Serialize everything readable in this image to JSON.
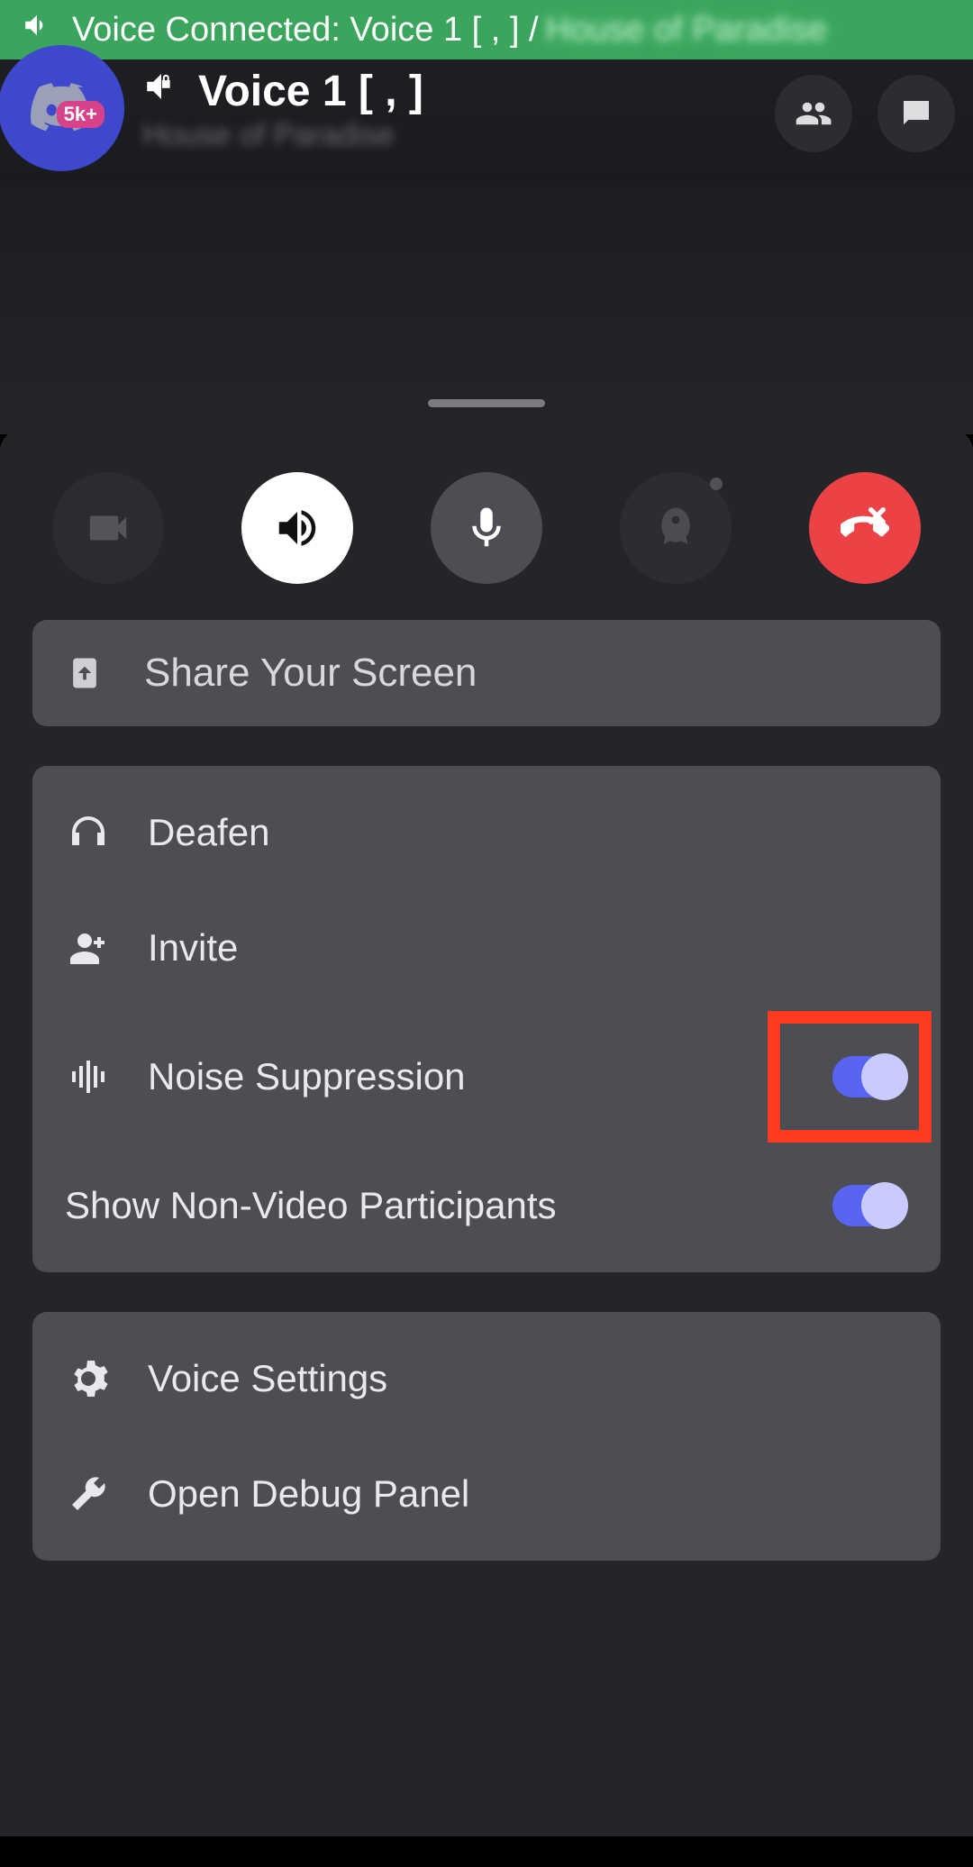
{
  "status_bar": {
    "text": "Voice Connected: Voice 1 [ , ] /",
    "blurred_suffix": "House of Paradise"
  },
  "header": {
    "server_badge": "5k+",
    "channel_name": "Voice 1 [ , ]",
    "server_name": "House of Paradise"
  },
  "share": {
    "label": "Share Your Screen"
  },
  "options": {
    "deafen": "Deafen",
    "invite": "Invite",
    "noise_suppression": "Noise Suppression",
    "show_non_video": "Show Non-Video Participants"
  },
  "settings": {
    "voice_settings": "Voice Settings",
    "debug_panel": "Open Debug Panel"
  },
  "toggles": {
    "noise_suppression": true,
    "show_non_video": true
  }
}
